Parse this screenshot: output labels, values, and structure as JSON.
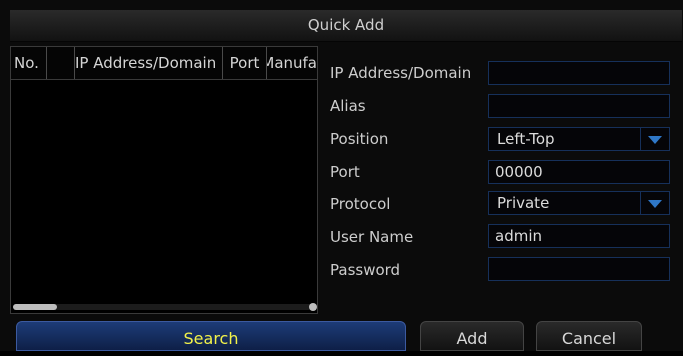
{
  "dialog": {
    "title": "Quick Add"
  },
  "device_list": {
    "columns": {
      "no": "No.",
      "ip": "IP Address/Domain",
      "port": "Port",
      "manufacturer": "Manufa"
    }
  },
  "form": {
    "ip_label": "IP Address/Domain",
    "ip_value": "",
    "alias_label": "Alias",
    "alias_value": "",
    "position_label": "Position",
    "position_value": "Left-Top",
    "port_label": "Port",
    "port_value": "00000",
    "protocol_label": "Protocol",
    "protocol_value": "Private",
    "username_label": "User Name",
    "username_value": "admin",
    "password_label": "Password",
    "password_value": ""
  },
  "buttons": {
    "search": "Search",
    "add": "Add",
    "cancel": "Cancel"
  },
  "colors": {
    "search_text": "#f2f24a",
    "field_border": "#16305a",
    "dropdown_arrow": "#2f78c8"
  },
  "icons": {
    "dropdown": "chevron-down-icon"
  }
}
